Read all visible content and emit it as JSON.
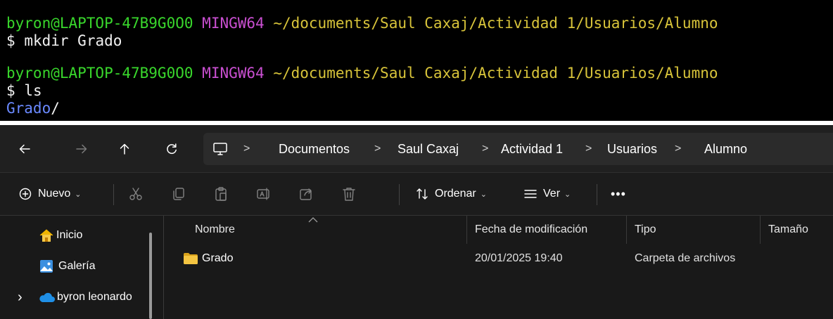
{
  "terminal": {
    "lines": [
      {
        "user": "byron@LAPTOP-47B9G0O0",
        "env": "MINGW64",
        "path": "~/documents/Saul Caxaj/Actividad 1/Usuarios/Alumno"
      },
      {
        "prompt": "$",
        "command": "mkdir Grado"
      },
      {
        "user": "byron@LAPTOP-47B9G0O0",
        "env": "MINGW64",
        "path": "~/documents/Saul Caxaj/Actividad 1/Usuarios/Alumno"
      },
      {
        "prompt": "$",
        "command": "ls"
      },
      {
        "output_dir": "Grado",
        "output_slash": "/"
      }
    ],
    "colors": {
      "user": "#39d72c",
      "env": "#c94fd1",
      "path": "#d8c43a",
      "dir": "#6a89ff"
    }
  },
  "explorer": {
    "nav": {
      "back_icon": "arrow-left-icon",
      "forward_icon": "arrow-right-icon",
      "up_icon": "arrow-up-icon",
      "refresh_icon": "refresh-icon"
    },
    "breadcrumb": {
      "root_icon": "computer-icon",
      "items": [
        "Documentos",
        "Saul Caxaj",
        "Actividad 1",
        "Usuarios",
        "Alumno"
      ],
      "separator": ">"
    },
    "toolbar": {
      "new_label": "Nuevo",
      "sort_label": "Ordenar",
      "view_label": "Ver",
      "more_label": "•••",
      "caret": "⌄"
    },
    "navpane": {
      "items": [
        {
          "label": "Inicio",
          "icon": "home-icon"
        },
        {
          "label": "Galería",
          "icon": "gallery-icon"
        },
        {
          "label": "byron leonardo",
          "icon": "onedrive-cloud-icon",
          "expander": "›"
        }
      ]
    },
    "columns": [
      "Nombre",
      "Fecha de modificación",
      "Tipo",
      "Tamaño"
    ],
    "rows": [
      {
        "name": "Grado",
        "modified": "20/01/2025 19:40",
        "type": "Carpeta de archivos",
        "size": ""
      }
    ]
  }
}
